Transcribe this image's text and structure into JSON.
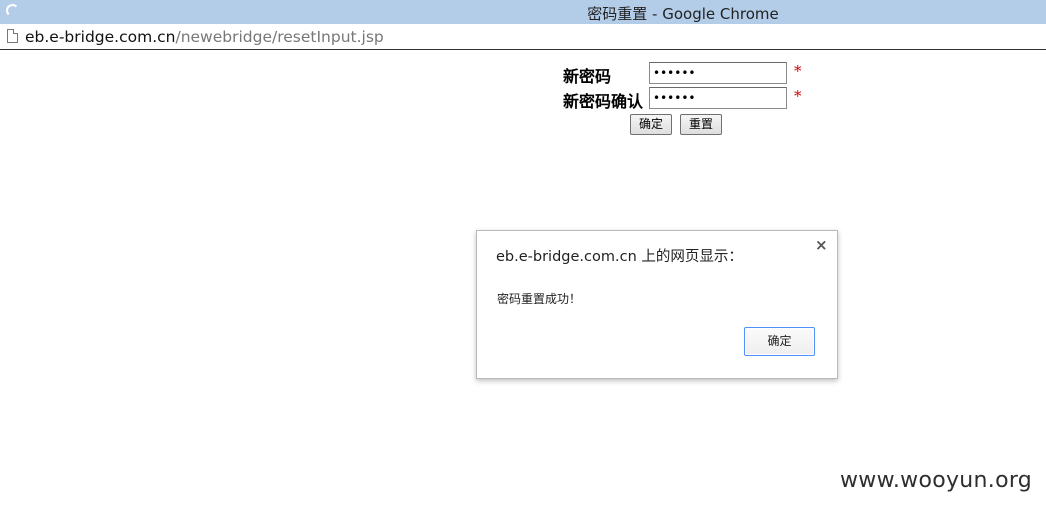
{
  "window": {
    "title": "密码重置 - Google Chrome"
  },
  "address_bar": {
    "host": "eb.e-bridge.com.cn",
    "path": "/newebridge/resetInput.jsp"
  },
  "form": {
    "new_password_label": "新密码",
    "confirm_password_label": "新密码确认",
    "new_password_value": "••••••",
    "confirm_password_value": "••••••",
    "required_mark": "*",
    "submit_label": "确定",
    "reset_label": "重置"
  },
  "dialog": {
    "title": "eb.e-bridge.com.cn 上的网页显示：",
    "close_glyph": "×",
    "message": "密码重置成功！",
    "ok_label": "确定"
  },
  "watermark": {
    "text": "www.wooyun.org"
  },
  "colors": {
    "titlebar": "#b3cde9",
    "required": "#d40000",
    "dialog_focus": "#4d90fe"
  },
  "icons": {
    "tab_loading": "loading-spinner-icon",
    "page": "page-icon",
    "close": "close-icon"
  }
}
